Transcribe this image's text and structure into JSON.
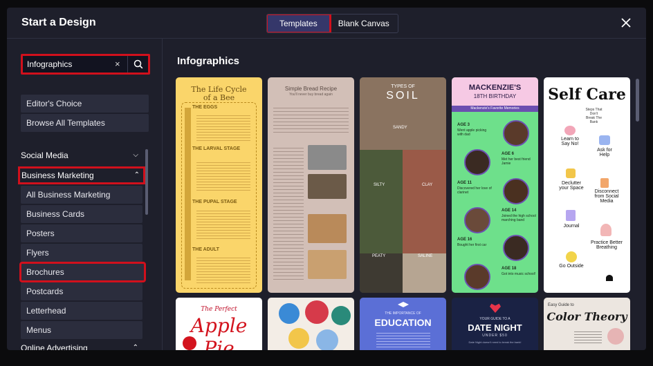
{
  "modal": {
    "title": "Start a Design",
    "tabs": [
      {
        "label": "Templates",
        "active": true
      },
      {
        "label": "Blank Canvas",
        "active": false
      }
    ],
    "close_icon": "close-icon"
  },
  "sidebar": {
    "search_value": "Infographics",
    "clear_icon": "×",
    "search_icon": "search-icon",
    "quick_links": [
      "Editor's Choice",
      "Browse All Templates"
    ],
    "categories": [
      {
        "label": "Social Media",
        "expanded": false
      },
      {
        "label": "Business Marketing",
        "expanded": true
      },
      {
        "label": "Online Advertising",
        "expanded": false
      }
    ],
    "business_items": [
      "All Business Marketing",
      "Business Cards",
      "Posters",
      "Flyers",
      "Brochures",
      "Postcards",
      "Letterhead",
      "Menus"
    ]
  },
  "main": {
    "section_title": "Infographics",
    "cards_row1": [
      {
        "title": "The Life Cycle of a Bee",
        "stages": [
          "THE EGGS",
          "THE LARVAL STAGE",
          "THE PUPAL STAGE",
          "THE ADULT"
        ],
        "bg": "#fad56a"
      },
      {
        "title": "Simple Bread Recipe",
        "subtitle": "You'll never buy bread again",
        "bg": "#c9b4ac"
      },
      {
        "title_small": "TYPES OF",
        "title": "SOIL",
        "labels": [
          "SANDY",
          "SILTY",
          "CLAY",
          "PEATY",
          "SALINE"
        ],
        "bg": "#6b5a4c"
      },
      {
        "title": "MACKENZIE'S",
        "subtitle": "18TH BIRTHDAY",
        "caption": "Mackenzie's Favorite Memories",
        "ages": [
          {
            "age": "AGE 3",
            "text": "Went apple picking with dad"
          },
          {
            "age": "AGE 6",
            "text": "Met her best friend Jamie"
          },
          {
            "age": "AGE 11",
            "text": "Discovered her love of clarinet"
          },
          {
            "age": "AGE 14",
            "text": "Joined the high school marching band"
          },
          {
            "age": "AGE 16",
            "text": "Bought her first car"
          },
          {
            "age": "AGE 18",
            "text": "Got into music school!"
          }
        ],
        "bg": "#6ee08b"
      },
      {
        "title": "Self Care",
        "subtitle": "Steps That Don't Break The Bank",
        "steps": [
          "Learn to Say No!",
          "Ask for Help",
          "Declutter your Space",
          "Disconnect from Social Media",
          "Journal",
          "Practice Better Breathing",
          "Go Outside"
        ],
        "bg": "#ffffff"
      }
    ],
    "cards_row2": [
      {
        "title_small": "The Perfect",
        "title": "Apple Pie",
        "bg": "#ffffff"
      },
      {
        "title": "",
        "bg": "#f3ede6"
      },
      {
        "title_small": "THE IMPORTANCE OF",
        "title": "EDUCATION",
        "bg": "#5b6fd6"
      },
      {
        "title_small": "YOUR GUIDE TO A",
        "title": "DATE NIGHT",
        "subtitle": "UNDER $50",
        "caption": "Date Night doesn't need to break the bank!",
        "bg": "#1a2244"
      },
      {
        "title_small": "Easy Guide to",
        "title": "Color Theory",
        "bg": "#ece6e0"
      }
    ]
  },
  "colors": {
    "highlight_red": "#d1101c",
    "modal_bg": "#1e1f2b",
    "item_bg": "#2b2d3d",
    "active_tab": "#35376a"
  }
}
